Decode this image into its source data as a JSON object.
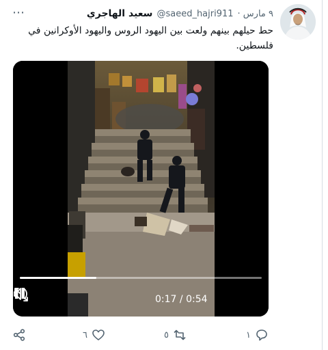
{
  "author": {
    "name": "سعيد الهاجري",
    "handle": "@saeed_hajri911",
    "date": "· ٩ مارس"
  },
  "more_icon": "⋯",
  "tweet_text": "حط حيلهم بينهم ولعت بين اليهود الروس واليهود الأوكرانين في فلسطين.",
  "video": {
    "current_time": "0:17",
    "duration": "0:54",
    "progress": 0.315,
    "icons": [
      "pause-icon",
      "volume-icon",
      "fullscreen-icon"
    ]
  },
  "actions": {
    "reply_count": "١",
    "retweet_count": "٥",
    "like_count": "٦",
    "icons": [
      "reply-icon",
      "retweet-icon",
      "like-icon",
      "share-icon"
    ]
  },
  "colors": {
    "text_primary": "#0f1419",
    "text_secondary": "#536471",
    "video_bg": "#000000"
  }
}
